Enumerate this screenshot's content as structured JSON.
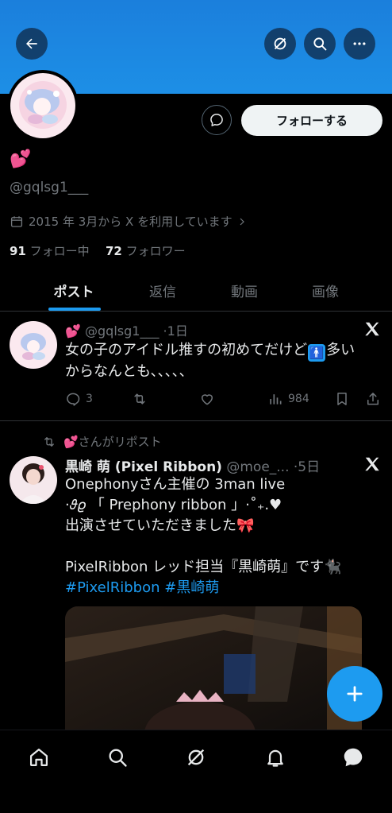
{
  "profile": {
    "display_name": "💕",
    "handle": "@gqlsg1___",
    "joined": "2015 年 3月から X を利用しています",
    "following_count": "91",
    "following_label": "フォロー中",
    "followers_count": "72",
    "followers_label": "フォロワー",
    "follow_label": "フォローする"
  },
  "tabs": [
    {
      "label": "ポスト",
      "active": true
    },
    {
      "label": "返信",
      "active": false
    },
    {
      "label": "動画",
      "active": false
    },
    {
      "label": "画像",
      "active": false
    }
  ],
  "posts": [
    {
      "name": "💕",
      "handle": "@gqlsg1___",
      "time": "·1日",
      "text_line1": "女の子のアイドル推すの初めてだけど",
      "text_after_emoji": "多い",
      "text_line2": "からなんとも、、、、、",
      "replies": "3",
      "views": "984"
    },
    {
      "repost_by": "💕さんがリポスト",
      "name": "黒崎 萌 (Pixel Ribbon)",
      "handle": "@moe_...",
      "time": "·5日",
      "line1": "Onephonyさん主催の 3man live",
      "line2": "·𝜗𝜚 「 Prephony ribbon 」⋅˚₊.♥",
      "line3": "出演させていただきました🎀",
      "line4": "PixelRibbon レッド担当『黒崎萌』です🐈‍⬛",
      "hashtag1": "#PixelRibbon",
      "hashtag2": "#黒崎萌"
    }
  ],
  "colors": {
    "accent": "#1d9bf0",
    "banner": "#1d8fe6",
    "background": "#000000"
  },
  "icons": [
    "back-arrow-icon",
    "grok-icon",
    "search-icon",
    "more-icon",
    "message-icon",
    "calendar-icon",
    "x-logo-icon",
    "reply-icon",
    "repost-icon",
    "like-icon",
    "views-icon",
    "bookmark-icon",
    "share-icon",
    "plus-icon",
    "home-icon",
    "messages-icon"
  ]
}
